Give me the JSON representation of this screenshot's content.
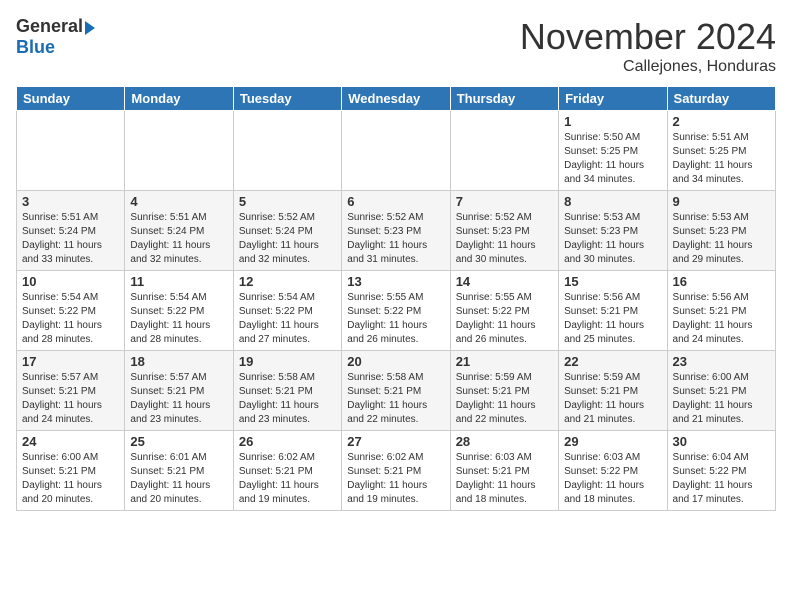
{
  "header": {
    "logo_general": "General",
    "logo_blue": "Blue",
    "month_title": "November 2024",
    "location": "Callejones, Honduras"
  },
  "weekdays": [
    "Sunday",
    "Monday",
    "Tuesday",
    "Wednesday",
    "Thursday",
    "Friday",
    "Saturday"
  ],
  "weeks": [
    [
      {
        "day": "",
        "info": ""
      },
      {
        "day": "",
        "info": ""
      },
      {
        "day": "",
        "info": ""
      },
      {
        "day": "",
        "info": ""
      },
      {
        "day": "",
        "info": ""
      },
      {
        "day": "1",
        "info": "Sunrise: 5:50 AM\nSunset: 5:25 PM\nDaylight: 11 hours\nand 34 minutes."
      },
      {
        "day": "2",
        "info": "Sunrise: 5:51 AM\nSunset: 5:25 PM\nDaylight: 11 hours\nand 34 minutes."
      }
    ],
    [
      {
        "day": "3",
        "info": "Sunrise: 5:51 AM\nSunset: 5:24 PM\nDaylight: 11 hours\nand 33 minutes."
      },
      {
        "day": "4",
        "info": "Sunrise: 5:51 AM\nSunset: 5:24 PM\nDaylight: 11 hours\nand 32 minutes."
      },
      {
        "day": "5",
        "info": "Sunrise: 5:52 AM\nSunset: 5:24 PM\nDaylight: 11 hours\nand 32 minutes."
      },
      {
        "day": "6",
        "info": "Sunrise: 5:52 AM\nSunset: 5:23 PM\nDaylight: 11 hours\nand 31 minutes."
      },
      {
        "day": "7",
        "info": "Sunrise: 5:52 AM\nSunset: 5:23 PM\nDaylight: 11 hours\nand 30 minutes."
      },
      {
        "day": "8",
        "info": "Sunrise: 5:53 AM\nSunset: 5:23 PM\nDaylight: 11 hours\nand 30 minutes."
      },
      {
        "day": "9",
        "info": "Sunrise: 5:53 AM\nSunset: 5:23 PM\nDaylight: 11 hours\nand 29 minutes."
      }
    ],
    [
      {
        "day": "10",
        "info": "Sunrise: 5:54 AM\nSunset: 5:22 PM\nDaylight: 11 hours\nand 28 minutes."
      },
      {
        "day": "11",
        "info": "Sunrise: 5:54 AM\nSunset: 5:22 PM\nDaylight: 11 hours\nand 28 minutes."
      },
      {
        "day": "12",
        "info": "Sunrise: 5:54 AM\nSunset: 5:22 PM\nDaylight: 11 hours\nand 27 minutes."
      },
      {
        "day": "13",
        "info": "Sunrise: 5:55 AM\nSunset: 5:22 PM\nDaylight: 11 hours\nand 26 minutes."
      },
      {
        "day": "14",
        "info": "Sunrise: 5:55 AM\nSunset: 5:22 PM\nDaylight: 11 hours\nand 26 minutes."
      },
      {
        "day": "15",
        "info": "Sunrise: 5:56 AM\nSunset: 5:21 PM\nDaylight: 11 hours\nand 25 minutes."
      },
      {
        "day": "16",
        "info": "Sunrise: 5:56 AM\nSunset: 5:21 PM\nDaylight: 11 hours\nand 24 minutes."
      }
    ],
    [
      {
        "day": "17",
        "info": "Sunrise: 5:57 AM\nSunset: 5:21 PM\nDaylight: 11 hours\nand 24 minutes."
      },
      {
        "day": "18",
        "info": "Sunrise: 5:57 AM\nSunset: 5:21 PM\nDaylight: 11 hours\nand 23 minutes."
      },
      {
        "day": "19",
        "info": "Sunrise: 5:58 AM\nSunset: 5:21 PM\nDaylight: 11 hours\nand 23 minutes."
      },
      {
        "day": "20",
        "info": "Sunrise: 5:58 AM\nSunset: 5:21 PM\nDaylight: 11 hours\nand 22 minutes."
      },
      {
        "day": "21",
        "info": "Sunrise: 5:59 AM\nSunset: 5:21 PM\nDaylight: 11 hours\nand 22 minutes."
      },
      {
        "day": "22",
        "info": "Sunrise: 5:59 AM\nSunset: 5:21 PM\nDaylight: 11 hours\nand 21 minutes."
      },
      {
        "day": "23",
        "info": "Sunrise: 6:00 AM\nSunset: 5:21 PM\nDaylight: 11 hours\nand 21 minutes."
      }
    ],
    [
      {
        "day": "24",
        "info": "Sunrise: 6:00 AM\nSunset: 5:21 PM\nDaylight: 11 hours\nand 20 minutes."
      },
      {
        "day": "25",
        "info": "Sunrise: 6:01 AM\nSunset: 5:21 PM\nDaylight: 11 hours\nand 20 minutes."
      },
      {
        "day": "26",
        "info": "Sunrise: 6:02 AM\nSunset: 5:21 PM\nDaylight: 11 hours\nand 19 minutes."
      },
      {
        "day": "27",
        "info": "Sunrise: 6:02 AM\nSunset: 5:21 PM\nDaylight: 11 hours\nand 19 minutes."
      },
      {
        "day": "28",
        "info": "Sunrise: 6:03 AM\nSunset: 5:21 PM\nDaylight: 11 hours\nand 18 minutes."
      },
      {
        "day": "29",
        "info": "Sunrise: 6:03 AM\nSunset: 5:22 PM\nDaylight: 11 hours\nand 18 minutes."
      },
      {
        "day": "30",
        "info": "Sunrise: 6:04 AM\nSunset: 5:22 PM\nDaylight: 11 hours\nand 17 minutes."
      }
    ]
  ]
}
